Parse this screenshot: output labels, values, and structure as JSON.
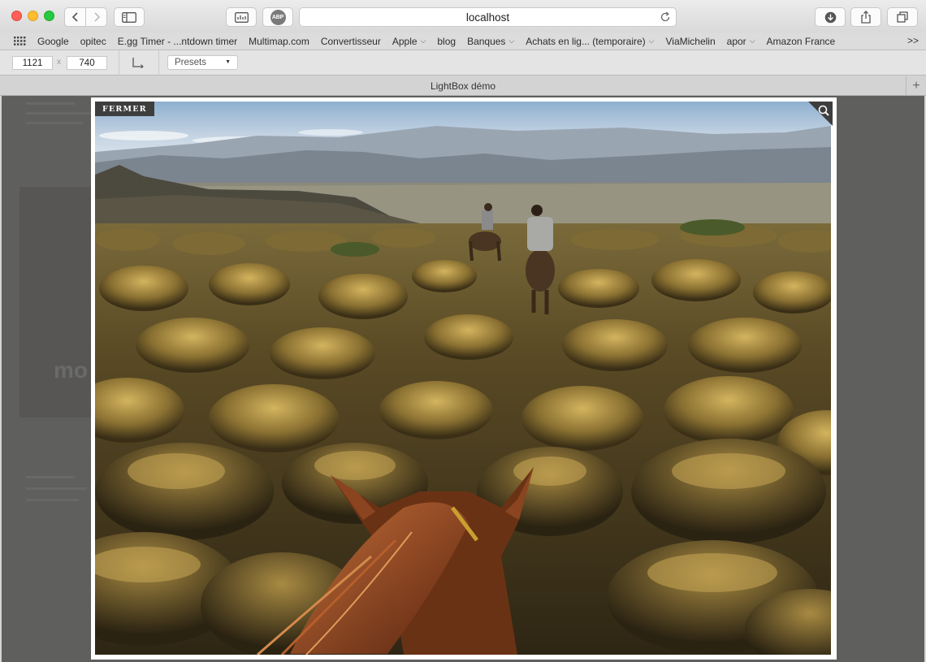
{
  "window": {
    "address": "localhost",
    "tab_title": "LightBox démo"
  },
  "bookmarks": {
    "items": [
      {
        "label": "Google",
        "menu": false
      },
      {
        "label": "opitec",
        "menu": false
      },
      {
        "label": "E.gg Timer - ...ntdown timer",
        "menu": false
      },
      {
        "label": "Multimap.com",
        "menu": false
      },
      {
        "label": "Convertisseur",
        "menu": false
      },
      {
        "label": "Apple",
        "menu": true
      },
      {
        "label": "blog",
        "menu": false
      },
      {
        "label": "Banques",
        "menu": true
      },
      {
        "label": "Achats en lig... (temporaire)",
        "menu": true
      },
      {
        "label": "ViaMichelin",
        "menu": false
      },
      {
        "label": "apor",
        "menu": true
      },
      {
        "label": "Amazon France",
        "menu": false
      }
    ],
    "more": ">>"
  },
  "responsive_toolbar": {
    "width": "1121",
    "separator": "x",
    "height": "740",
    "presets_label": "Presets"
  },
  "page": {
    "background_text": "mo"
  },
  "lightbox": {
    "close_label": "FERMER",
    "zoom_icon": "magnifier-icon"
  },
  "colors": {
    "overlay": "#5f5f5d",
    "close_button_bg": "#3e3e3e",
    "lightbox_frame": "#ffffff"
  }
}
